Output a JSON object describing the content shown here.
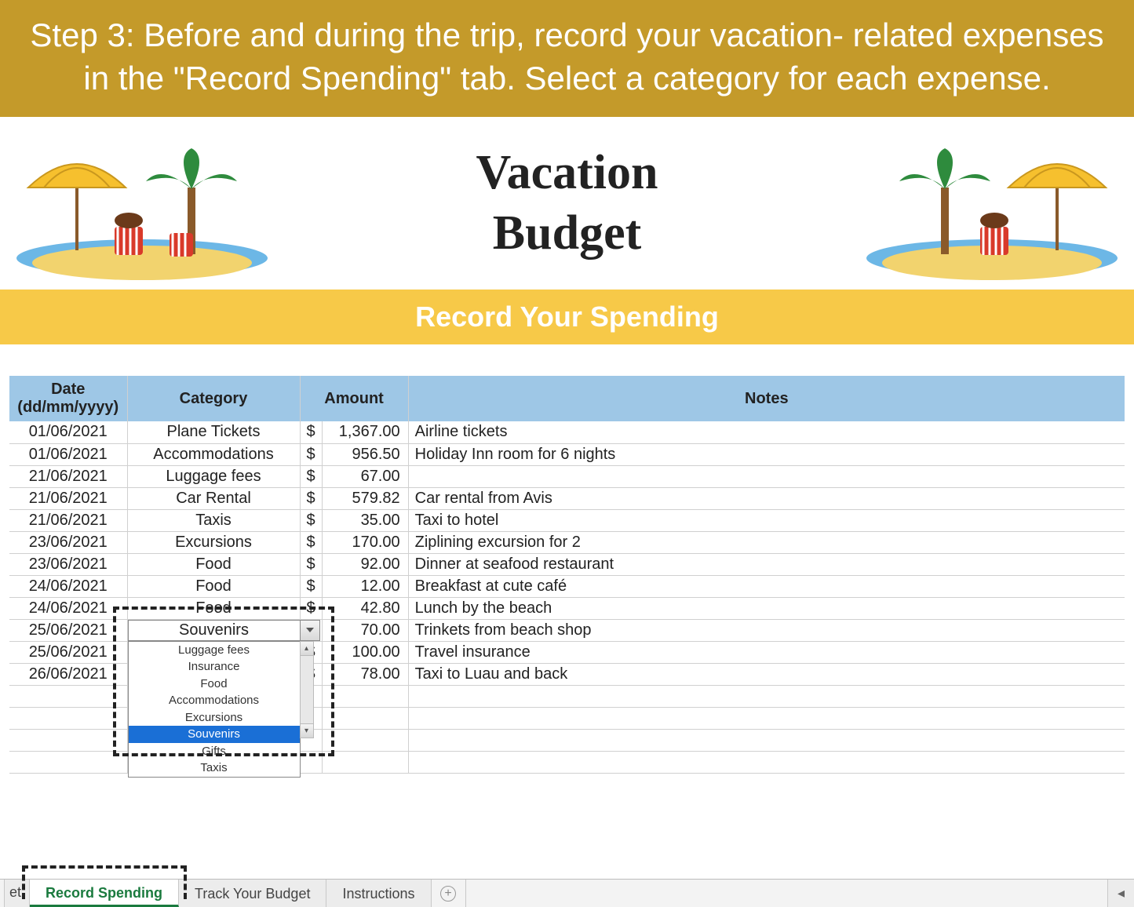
{
  "banner": "Step 3: Before and during the trip, record your vacation- related expenses in the \"Record Spending\" tab. Select a category for each expense.",
  "header": {
    "title_line1": "Vacation",
    "title_line2": "Budget"
  },
  "section_heading": "Record Your Spending",
  "table": {
    "headers": {
      "date": "Date\n(dd/mm/yyyy)",
      "category": "Category",
      "amount": "Amount",
      "notes": "Notes"
    },
    "currency": "$",
    "rows": [
      {
        "date": "01/06/2021",
        "category": "Plane Tickets",
        "amount": "1,367.00",
        "notes": "Airline tickets"
      },
      {
        "date": "01/06/2021",
        "category": "Accommodations",
        "amount": "956.50",
        "notes": "Holiday Inn room for 6 nights"
      },
      {
        "date": "21/06/2021",
        "category": "Luggage fees",
        "amount": "67.00",
        "notes": ""
      },
      {
        "date": "21/06/2021",
        "category": "Car Rental",
        "amount": "579.82",
        "notes": "Car rental from Avis"
      },
      {
        "date": "21/06/2021",
        "category": "Taxis",
        "amount": "35.00",
        "notes": "Taxi to hotel"
      },
      {
        "date": "23/06/2021",
        "category": "Excursions",
        "amount": "170.00",
        "notes": "Ziplining excursion for 2"
      },
      {
        "date": "23/06/2021",
        "category": "Food",
        "amount": "92.00",
        "notes": "Dinner at seafood restaurant"
      },
      {
        "date": "24/06/2021",
        "category": "Food",
        "amount": "12.00",
        "notes": "Breakfast at cute café"
      },
      {
        "date": "24/06/2021",
        "category": "Food",
        "amount": "42.80",
        "notes": "Lunch by the beach"
      },
      {
        "date": "25/06/2021",
        "category": "Souvenirs",
        "amount": "70.00",
        "notes": "Trinkets from beach shop",
        "dropdown": true
      },
      {
        "date": "25/06/2021",
        "category": "",
        "amount": "100.00",
        "notes": "Travel insurance"
      },
      {
        "date": "26/06/2021",
        "category": "",
        "amount": "78.00",
        "notes": "Taxi to Luau and back"
      }
    ],
    "empty_rows": 4
  },
  "dropdown": {
    "selected": "Souvenirs",
    "options": [
      "Luggage fees",
      "Insurance",
      "Food",
      "Accommodations",
      "Excursions",
      "Souvenirs",
      "Gifts",
      "Taxis"
    ]
  },
  "tabs": {
    "partial": "et",
    "items": [
      {
        "name": "Record Spending",
        "active": true
      },
      {
        "name": "Track Your Budget",
        "active": false
      },
      {
        "name": "Instructions",
        "active": false
      }
    ]
  }
}
